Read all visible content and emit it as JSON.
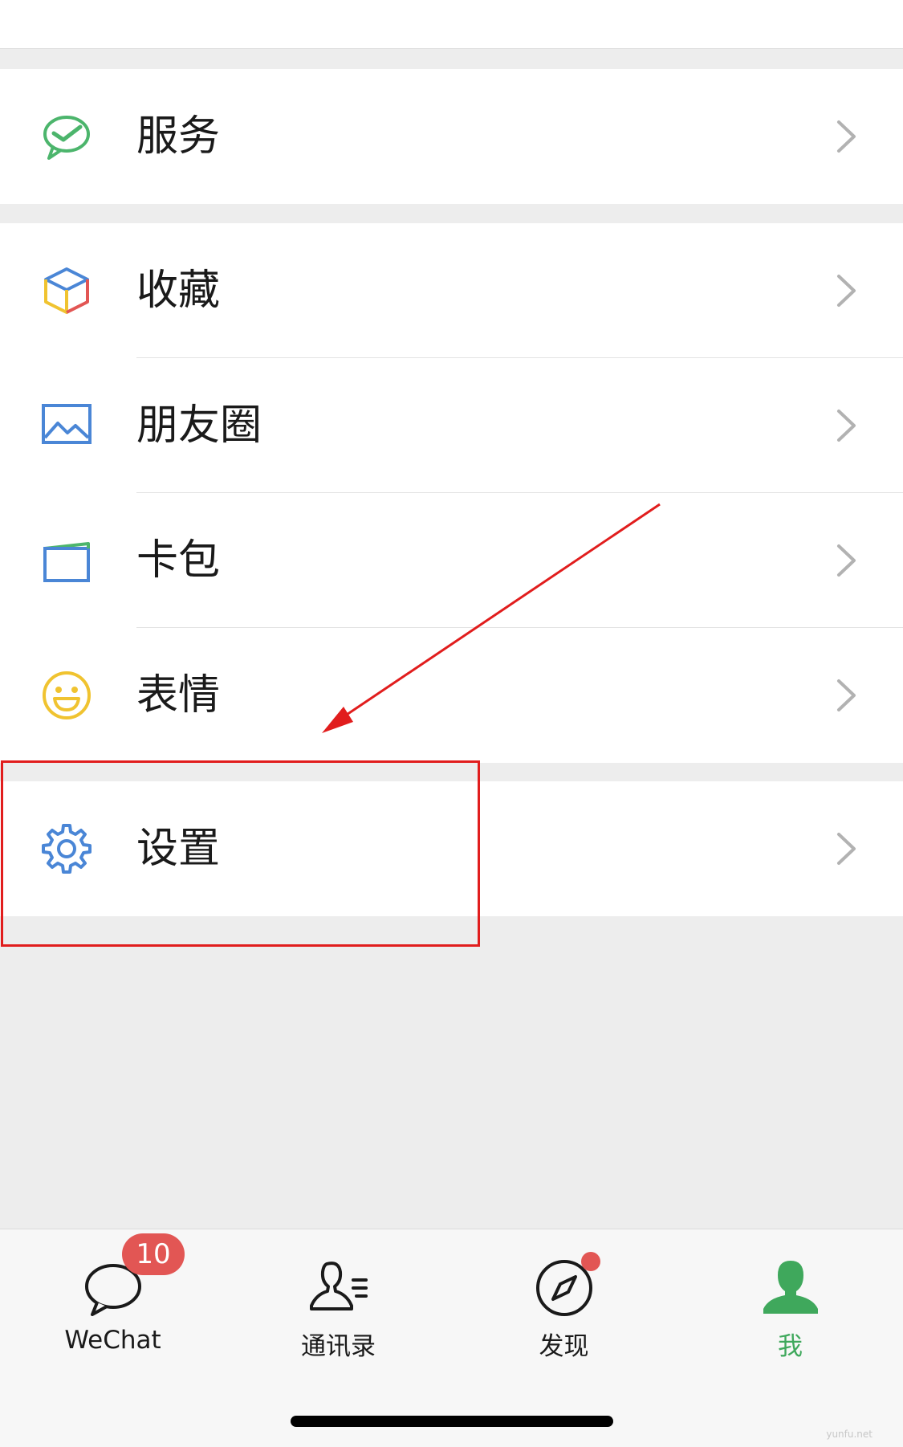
{
  "menu": {
    "services": {
      "label": "服务",
      "icon": "wechat-pay-icon"
    },
    "favorites": {
      "label": "收藏",
      "icon": "favorites-cube-icon"
    },
    "moments": {
      "label": "朋友圈",
      "icon": "photo-album-icon"
    },
    "cards": {
      "label": "卡包",
      "icon": "card-wallet-icon"
    },
    "stickers": {
      "label": "表情",
      "icon": "smiley-icon"
    },
    "settings": {
      "label": "设置",
      "icon": "gear-icon"
    }
  },
  "tabbar": {
    "tabs": [
      {
        "label": "WeChat",
        "icon": "chat-bubble-icon",
        "badge": "10"
      },
      {
        "label": "通讯录",
        "icon": "contacts-icon"
      },
      {
        "label": "发现",
        "icon": "compass-icon",
        "dot": true
      },
      {
        "label": "我",
        "icon": "person-icon",
        "active": true
      }
    ]
  },
  "watermark": "yunfu.net",
  "colors": {
    "accent_green": "#3fa85c",
    "badge_red": "#e25654",
    "annotation_red": "#e11d1d",
    "background": "#ededed"
  }
}
